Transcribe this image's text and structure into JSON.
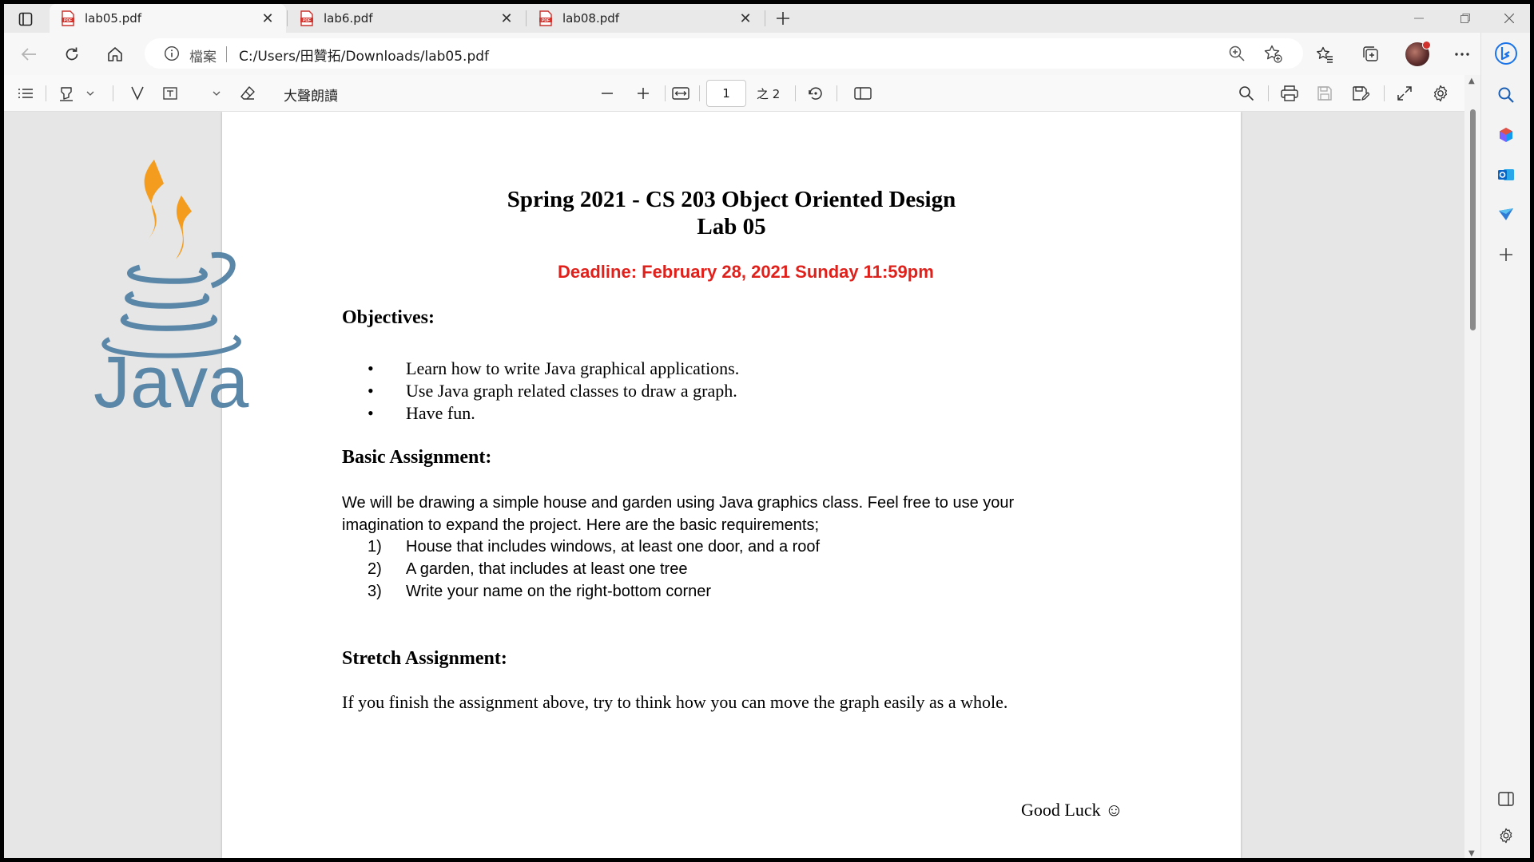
{
  "tabs": [
    {
      "title": "lab05.pdf",
      "active": true
    },
    {
      "title": "lab6.pdf",
      "active": false
    },
    {
      "title": "lab08.pdf",
      "active": false
    }
  ],
  "address": {
    "label": "檔案",
    "url": "C:/Users/田贊拓/Downloads/lab05.pdf"
  },
  "pdf_toolbar": {
    "read_aloud": "大聲朗讀",
    "page_number": "1",
    "page_total": "之 2"
  },
  "document": {
    "title_line1": "Spring 2021 - CS 203 Object Oriented Design",
    "title_line2": "Lab 05",
    "deadline": "Deadline: February 28, 2021 Sunday 11:59pm",
    "objectives_heading": "Objectives:",
    "objectives": [
      "Learn how to write Java graphical applications.",
      "Use Java graph related classes to draw a graph.",
      "Have fun."
    ],
    "basic_heading": "Basic Assignment:",
    "basic_para_line1": "We will be drawing a simple house and garden using Java graphics class. Feel free to use your",
    "basic_para_line2": "imagination to expand the project. Here are the basic requirements;",
    "requirements": [
      {
        "num": "1)",
        "text": "House that includes windows, at least one door, and a roof"
      },
      {
        "num": "2)",
        "text": "A garden, that includes at least one tree"
      },
      {
        "num": "3)",
        "text": "Write your name on the right-bottom corner"
      }
    ],
    "stretch_heading": "Stretch Assignment:",
    "stretch_text": "If you finish the assignment above, try to think how you can move the graph easily as a whole.",
    "good_luck": "Good Luck ☺"
  },
  "overlay_logo": {
    "text": "Java"
  },
  "colors": {
    "deadline_red": "#e0201b",
    "java_orange": "#f39c1e",
    "java_blue": "#5a86a8",
    "edge_accent": "#1a73e8"
  }
}
